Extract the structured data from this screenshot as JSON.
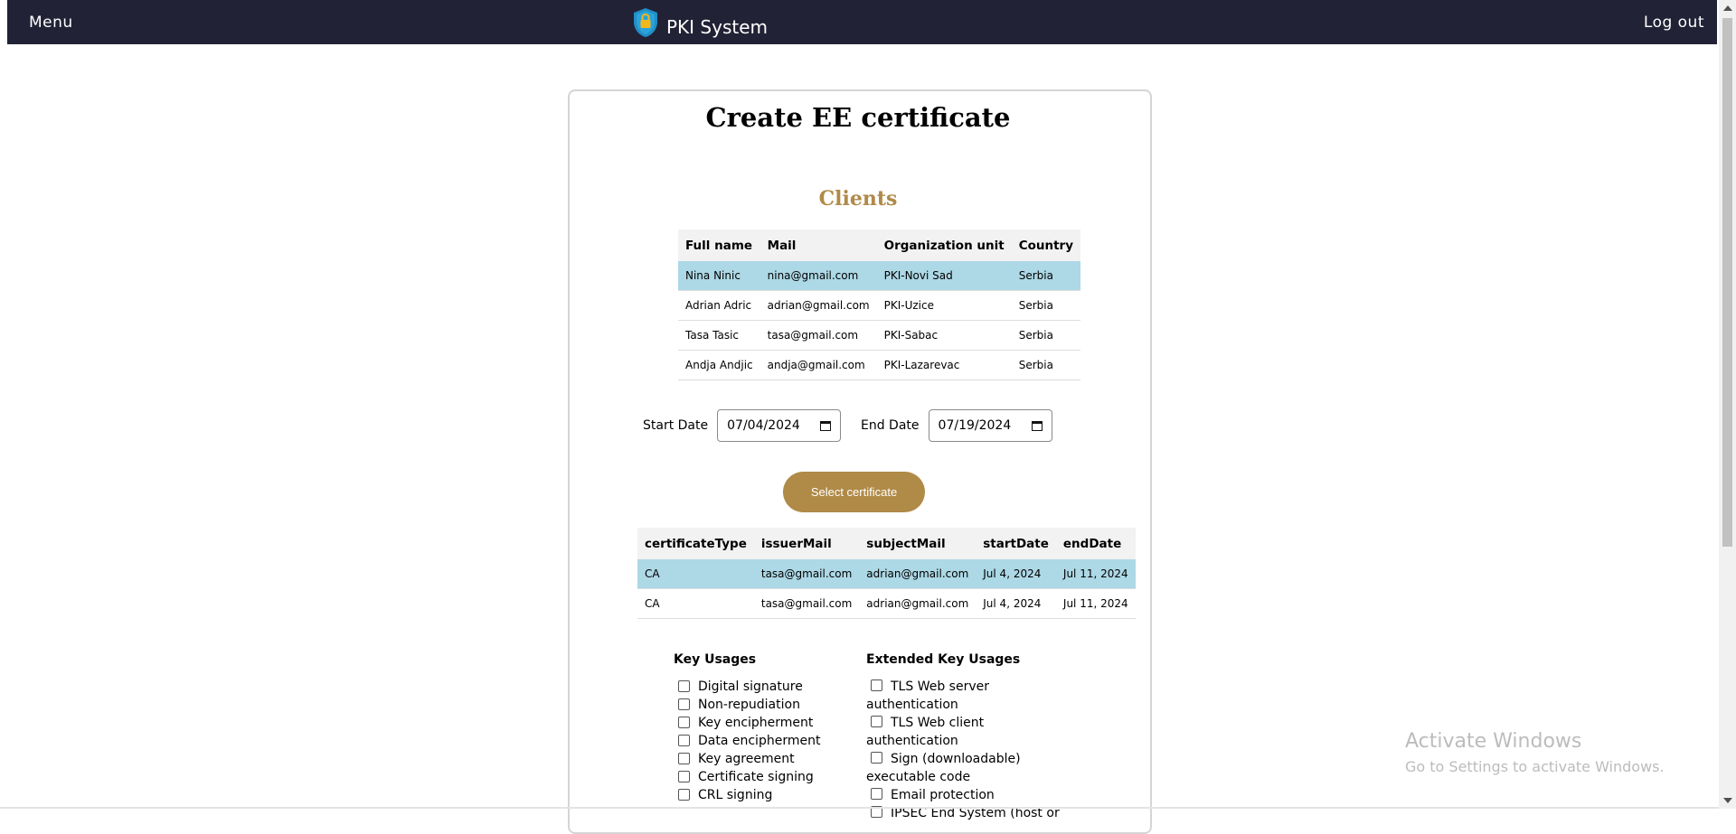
{
  "navbar": {
    "menu_label": "Menu",
    "brand": "PKI System",
    "logout_label": "Log out"
  },
  "page": {
    "title": "Create EE certificate",
    "clients_heading": "Clients"
  },
  "clients": {
    "headers": [
      "Full name",
      "Mail",
      "Organization unit",
      "Country"
    ],
    "rows": [
      [
        "Nina Ninic",
        "nina@gmail.com",
        "PKI-Novi Sad",
        "Serbia"
      ],
      [
        "Adrian Adric",
        "adrian@gmail.com",
        "PKI-Uzice",
        "Serbia"
      ],
      [
        "Tasa Tasic",
        "tasa@gmail.com",
        "PKI-Sabac",
        "Serbia"
      ],
      [
        "Andja Andjic",
        "andja@gmail.com",
        "PKI-Lazarevac",
        "Serbia"
      ]
    ],
    "selected_index": 0
  },
  "dates": {
    "start_label": "Start Date",
    "start_value": "07/04/2024",
    "end_label": "End Date",
    "end_value": "07/19/2024"
  },
  "select_button_label": "Select certificate",
  "certificates": {
    "headers": [
      "certificateType",
      "issuerMail",
      "subjectMail",
      "startDate",
      "endDate"
    ],
    "rows": [
      [
        "CA",
        "tasa@gmail.com",
        "adrian@gmail.com",
        "Jul 4, 2024",
        "Jul 11, 2024"
      ],
      [
        "CA",
        "tasa@gmail.com",
        "adrian@gmail.com",
        "Jul 4, 2024",
        "Jul 11, 2024"
      ]
    ],
    "selected_index": 0
  },
  "key_usages": {
    "heading": "Key Usages",
    "items": [
      "Digital signature",
      "Non-repudiation",
      "Key encipherment",
      "Data encipherment",
      "Key agreement",
      "Certificate signing",
      "CRL signing"
    ]
  },
  "extended_key_usages": {
    "heading": "Extended Key Usages",
    "items": [
      "TLS Web server authentication",
      "TLS Web client authentication",
      "Sign (downloadable) executable code",
      "Email protection",
      "IPSEC End System (host or"
    ]
  },
  "windows_watermark": {
    "line1": "Activate Windows",
    "line2": "Go to Settings to activate Windows."
  },
  "colors": {
    "navbar": "#222236",
    "accent": "#b08a47",
    "selected_row": "#add8e6"
  }
}
